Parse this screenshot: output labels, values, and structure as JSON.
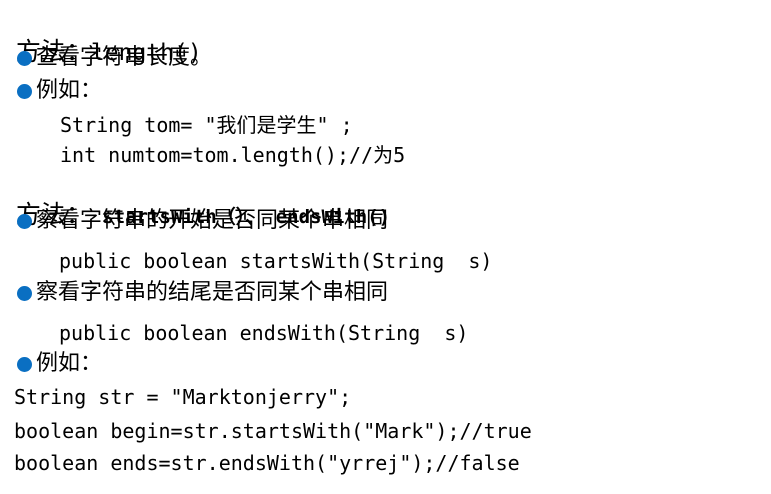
{
  "colors": {
    "bullet": "#0a6fc2",
    "text": "#000000",
    "background": "#ffffff"
  },
  "icons": {
    "bullet": "bullet-dot-icon"
  },
  "section1": {
    "heading_prefix": "方法：",
    "heading_method": "length()",
    "bullet1": "查看字符串长度。",
    "bullet2": "例如：",
    "code": [
      "String tom= \"我们是学生\" ;",
      "int numtom=tom.length();//为5"
    ]
  },
  "section2": {
    "heading_prefix": "方法：",
    "heading_method": " startsWith（）、 endsWith()",
    "bullet1": "察看字符串的开始是否同某个串相同",
    "code1": "public boolean startsWith(String  s)",
    "bullet2": "察看字符串的结尾是否同某个串相同",
    "code2": "public boolean endsWith(String  s)",
    "bullet3": "例如：",
    "example_code": [
      "String str = \"Marktonjerry\";",
      "boolean begin=str.startsWith(\"Mark\");//true",
      "boolean ends=str.endsWith(\"yrrej\");//false"
    ]
  }
}
